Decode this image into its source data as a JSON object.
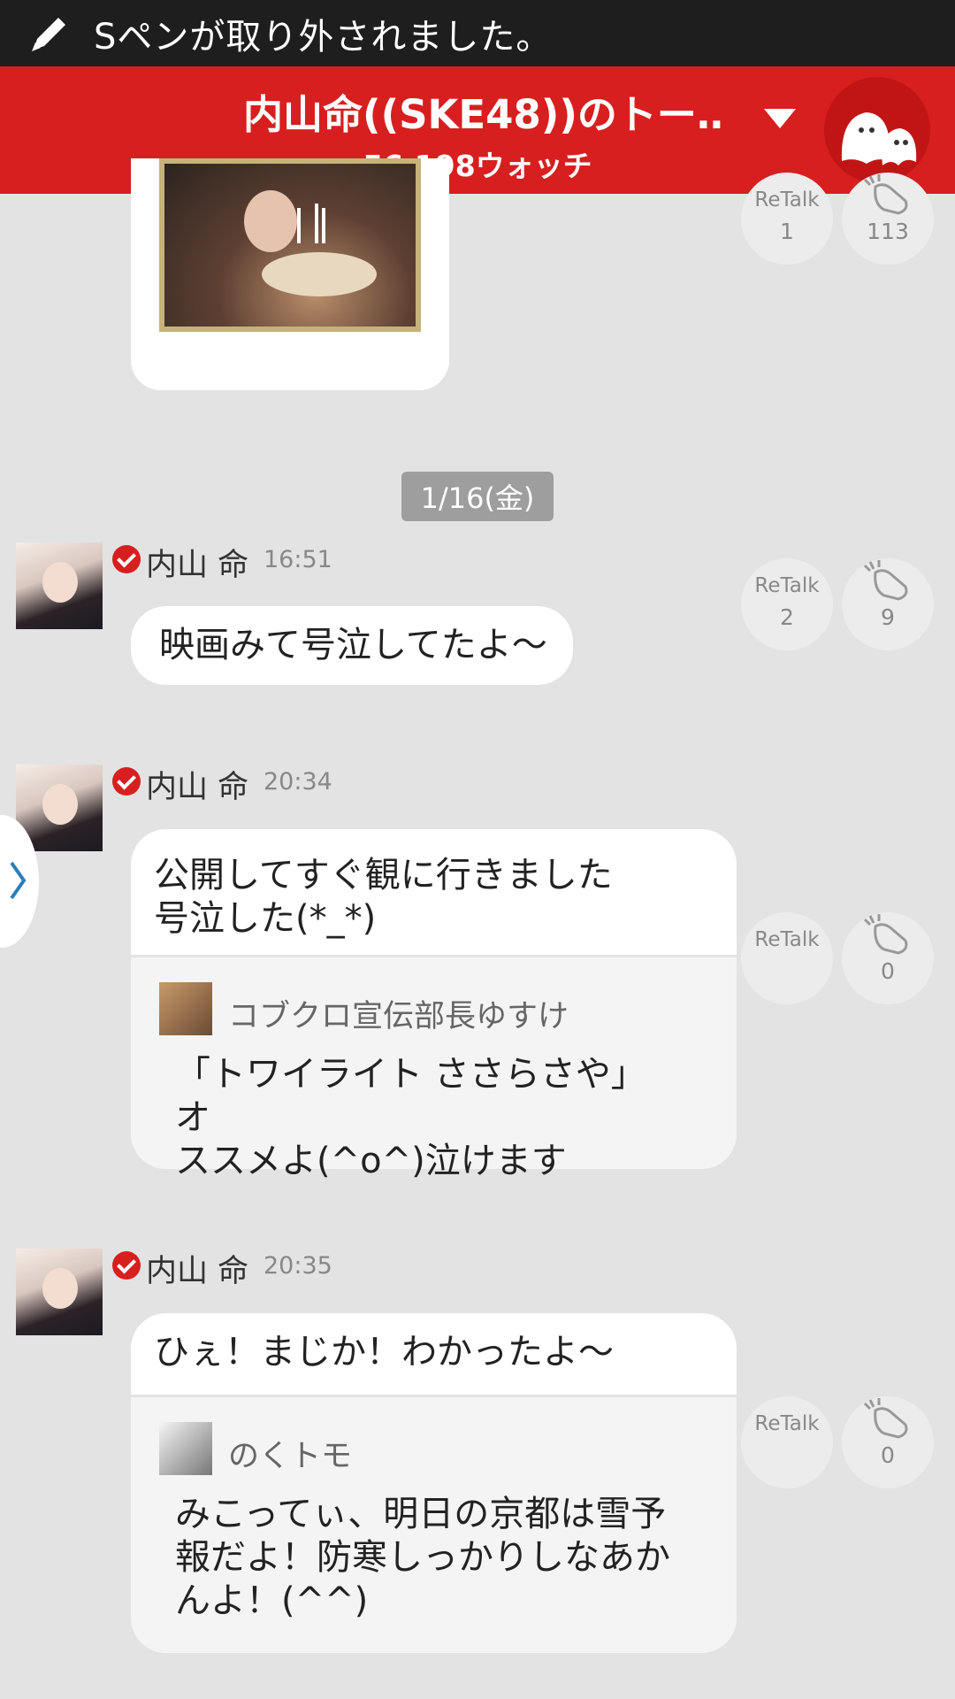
{
  "notification": {
    "text": "Sペンが取り外されました。",
    "icon": "pen-icon"
  },
  "header": {
    "title": "内山命((SKE48))のトー…",
    "watch_count": "56,198ウォッチ",
    "dropdown_icon": "chevron-down-icon",
    "mascot_icon": "ghost-mascot-icon"
  },
  "top_message": {
    "retalk_label": "ReTalk",
    "retalk_count": "1",
    "clap_count": "113"
  },
  "date_separator": "1/16(金)",
  "messages": [
    {
      "author": "内山 命",
      "time": "16:51",
      "text": "映画みて号泣してたよ〜",
      "retalk_label": "ReTalk",
      "retalk_count": "2",
      "clap_count": "9"
    },
    {
      "author": "内山 命",
      "time": "20:34",
      "text_line1": "公開してすぐ観に行きました",
      "text_line2": "号泣した(*_*)",
      "quote_author": "コブクロ宣伝部長ゆすけ",
      "quote_line1": "「トワイライト ささらさや」オ",
      "quote_line2": "ススメよ(^o^)泣けます",
      "retalk_label": "ReTalk",
      "clap_count": "0"
    },
    {
      "author": "内山 命",
      "time": "20:35",
      "text": "ひぇ！まじか！わかったよ〜",
      "quote_author": "のくトモ",
      "quote_line1": "みこってぃ、明日の京都は雪予",
      "quote_line2": "報だよ！防寒しっかりしなあか",
      "quote_line3": "んよ！(^^)",
      "retalk_label": "ReTalk",
      "clap_count": "0"
    }
  ],
  "colors": {
    "brand_red": "#d71f1f",
    "background": "#e3e3e3",
    "badge_gray": "#9e9e9e"
  }
}
